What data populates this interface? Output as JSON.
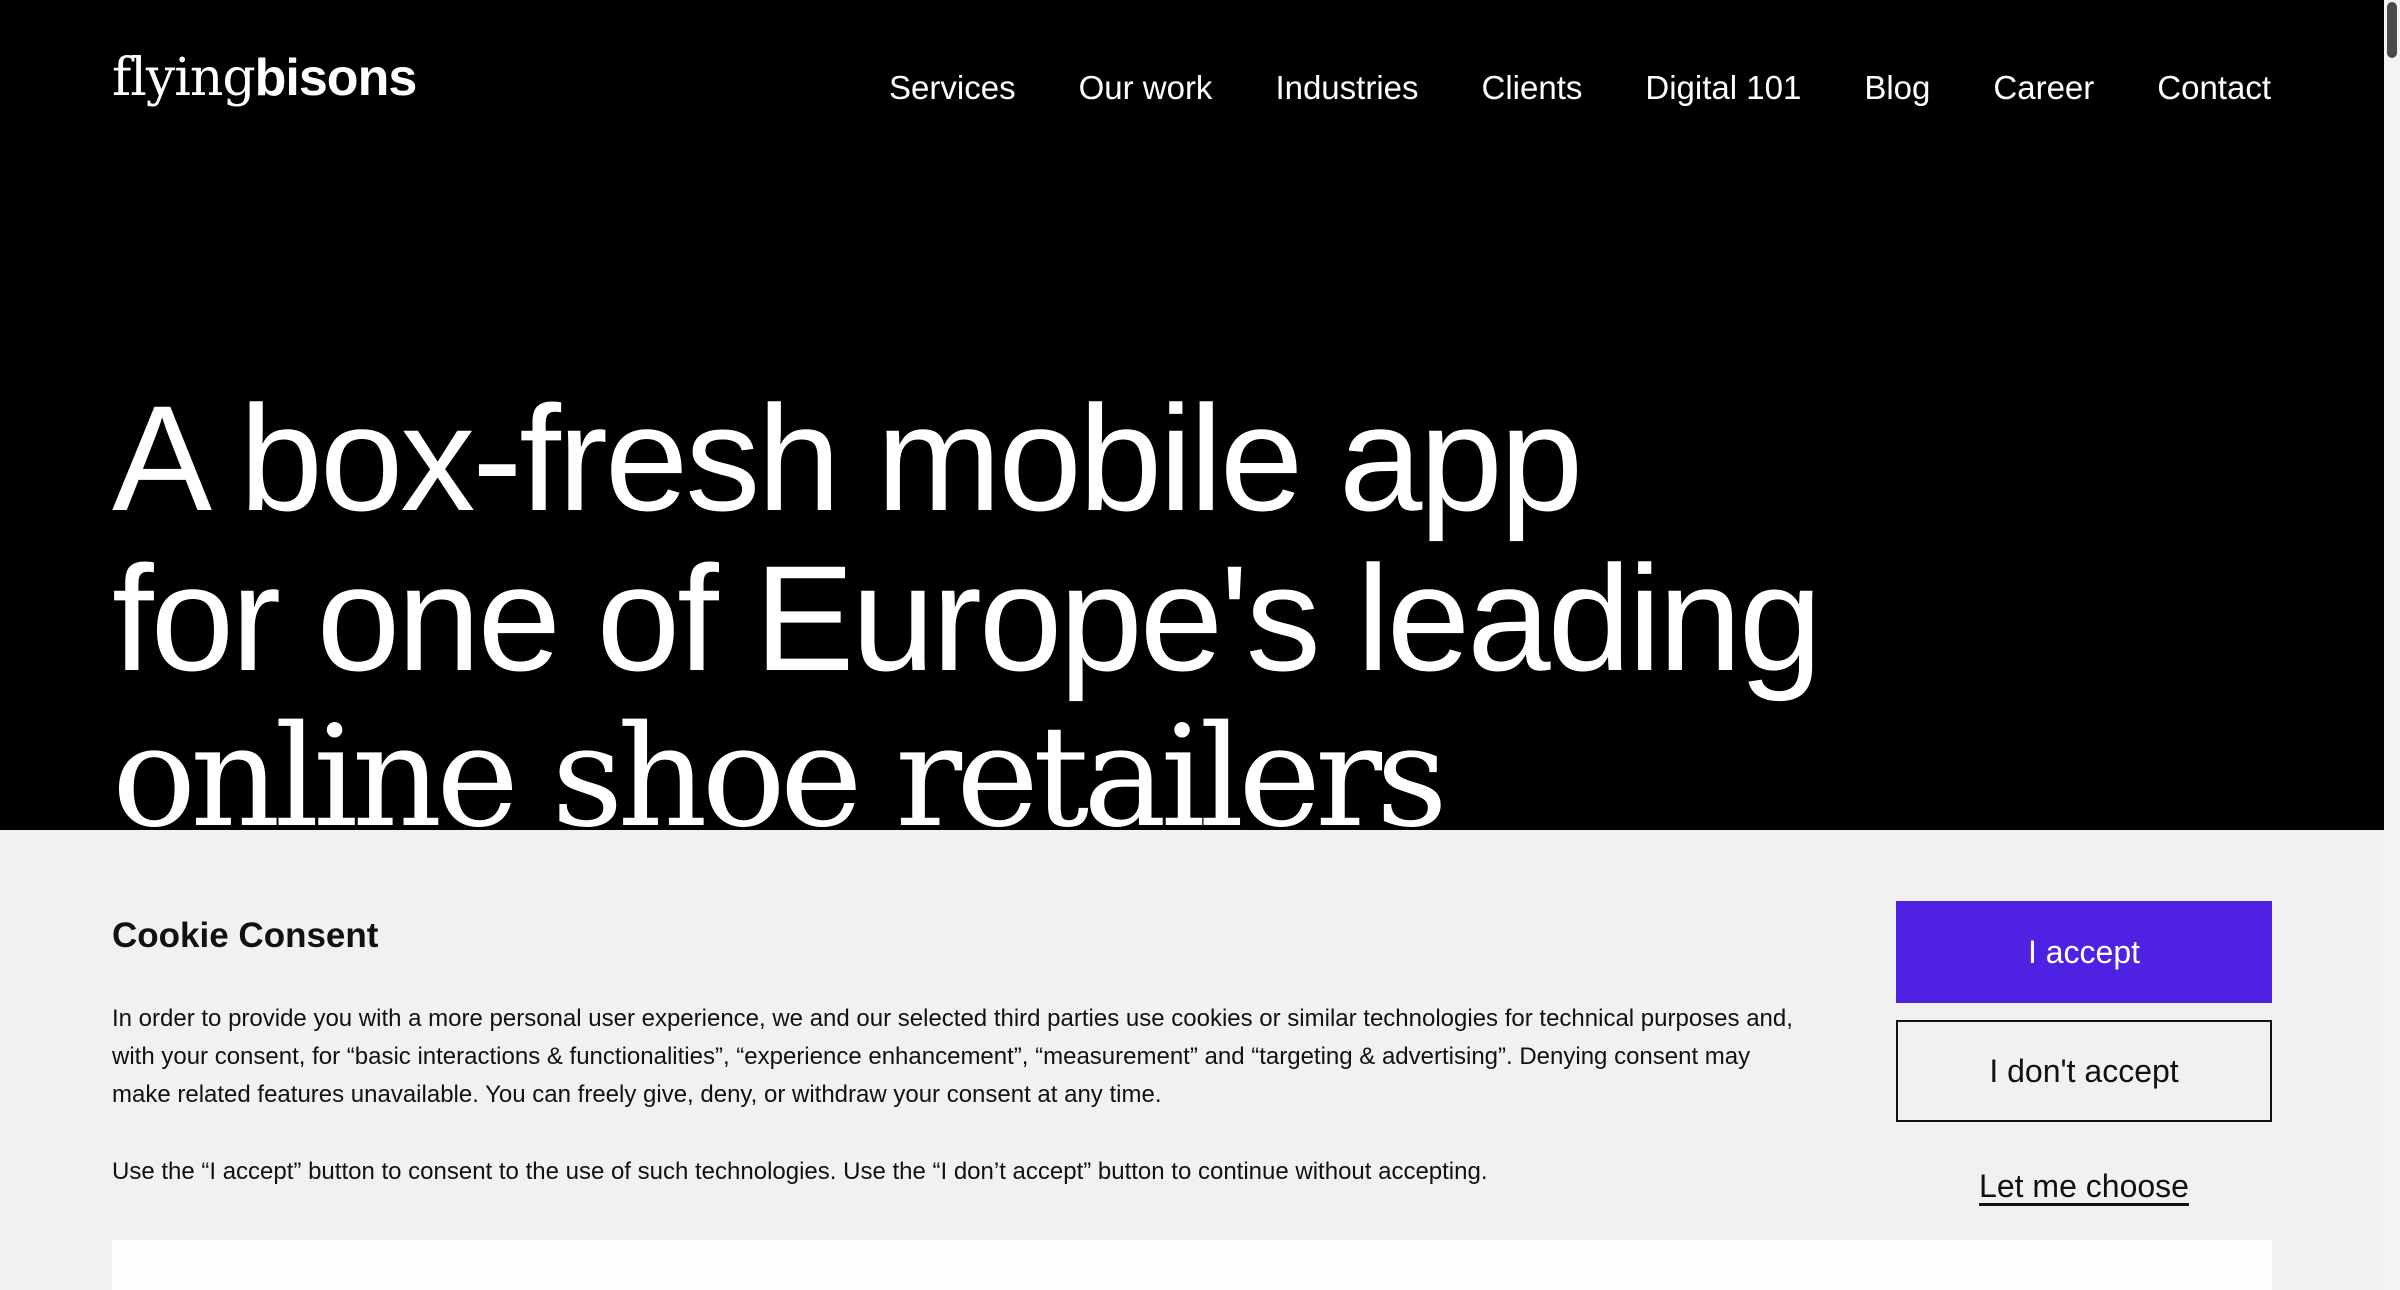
{
  "logo": {
    "part1": "flying",
    "part2": "bisons"
  },
  "nav": {
    "items": [
      {
        "id": "services",
        "label": "Services"
      },
      {
        "id": "our-work",
        "label": "Our work"
      },
      {
        "id": "industries",
        "label": "Industries"
      },
      {
        "id": "clients",
        "label": "Clients"
      },
      {
        "id": "digital-101",
        "label": "Digital 101"
      },
      {
        "id": "blog",
        "label": "Blog"
      },
      {
        "id": "career",
        "label": "Career"
      },
      {
        "id": "contact",
        "label": "Contact"
      }
    ]
  },
  "hero": {
    "line1": "A box-fresh mobile app",
    "line2": "for one of Europe's leading",
    "line3": "online shoe retailers"
  },
  "cookie": {
    "title": "Cookie Consent",
    "paragraph1": "In order to provide you with a more personal user experience, we and our selected third parties use cookies or similar technologies for technical purposes and, with your consent, for “basic interactions & functionalities”, “experience enhancement”, “measurement” and “targeting & advertising”. Denying consent may make related features unavailable. You can freely give, deny, or withdraw your consent at any time.",
    "paragraph2": "Use the “I accept” button to consent to the use of such technologies. Use the “I don’t accept” button to continue without accepting.",
    "accept_label": "I accept",
    "deny_label": "I don't accept",
    "choose_label": "Let me choose"
  },
  "colors": {
    "accent": "#4f21e3",
    "background": "#000000",
    "banner": "#f1f1f1"
  }
}
